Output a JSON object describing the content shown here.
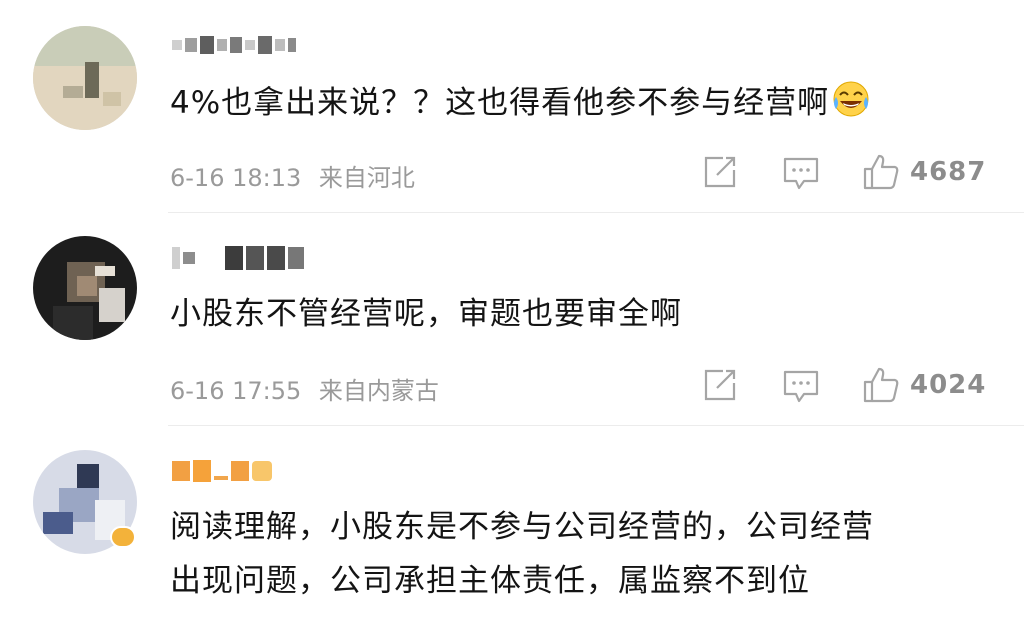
{
  "comments": [
    {
      "username": "",
      "text": "4%也拿出来说？？这也得看他参不参与经营啊",
      "emoji": "laugh-cry-emoji",
      "date": "6-16 18:13",
      "location": "来自河北",
      "likes": "4687"
    },
    {
      "username": "",
      "text": "小股东不管经营呢，审题也要审全啊",
      "emoji": "",
      "date": "6-16 17:55",
      "location": "来自内蒙古",
      "likes": "4024"
    },
    {
      "username": "",
      "text_line1": "阅读理解，小股东是不参与公司经营的，公司经营",
      "text_line2": "出现问题，公司承担主体责任，属监察不到位",
      "emoji": "",
      "date": "",
      "location": "",
      "likes": ""
    }
  ],
  "icons": {
    "share": "share-icon",
    "comment": "comment-icon",
    "like": "thumbs-up-icon"
  },
  "colors": {
    "meta_text": "#9a9a9a",
    "icon": "#a5a5a5",
    "username_orange": "#f5a23a"
  }
}
